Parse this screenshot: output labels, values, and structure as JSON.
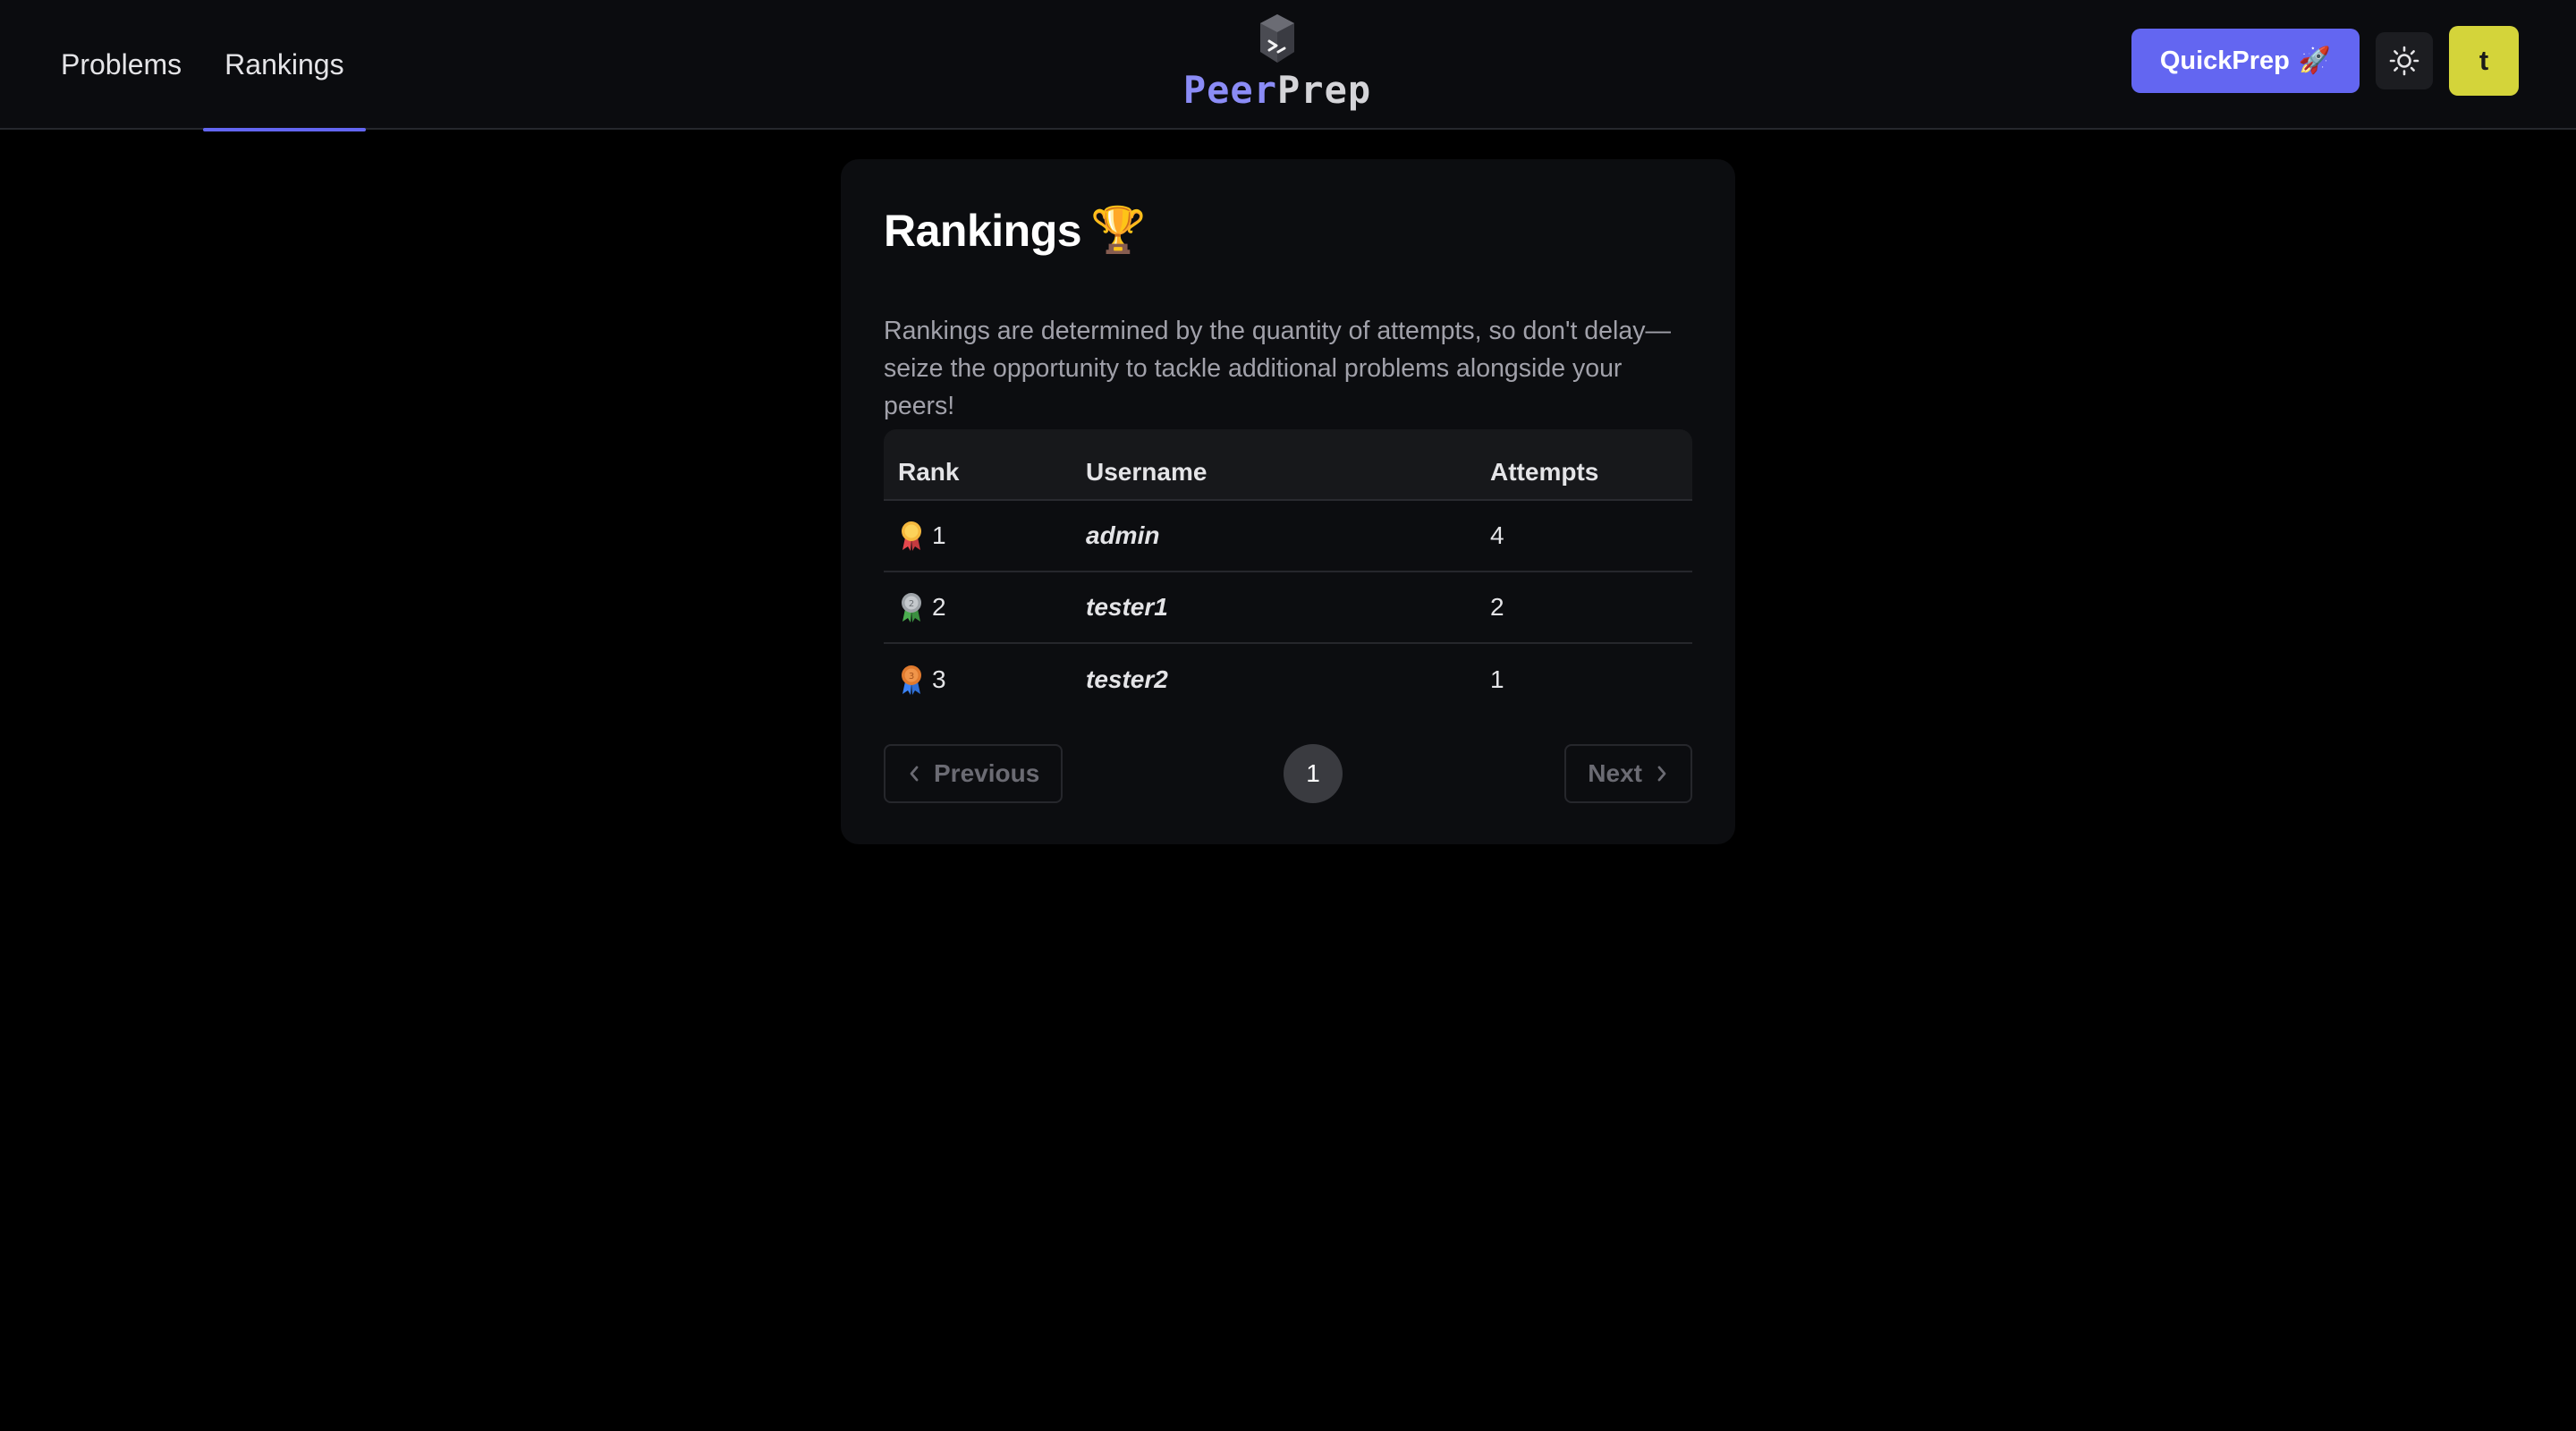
{
  "nav": {
    "links": [
      {
        "label": "Problems",
        "active": false
      },
      {
        "label": "Rankings",
        "active": true
      }
    ]
  },
  "brand": {
    "part1": "Peer",
    "part2": "Prep",
    "icon": "terminal-cube-icon"
  },
  "actions": {
    "quickprep_label": "QuickPrep",
    "quickprep_emoji": "🚀",
    "theme_icon": "sun-icon",
    "avatar_letter": "t",
    "avatar_color": "#d4d43a"
  },
  "rankings": {
    "title": "Rankings",
    "title_emoji": "🏆",
    "description": "Rankings are determined by the quantity of attempts, so don't delay—seize the opportunity to tackle additional problems alongside your peers!",
    "columns": [
      "Rank",
      "Username",
      "Attempts"
    ],
    "rows": [
      {
        "rank": "1",
        "medal": "gold-medal-icon",
        "username": "admin",
        "attempts": "4"
      },
      {
        "rank": "2",
        "medal": "silver-medal-icon",
        "username": "tester1",
        "attempts": "2"
      },
      {
        "rank": "3",
        "medal": "bronze-medal-icon",
        "username": "tester2",
        "attempts": "1"
      }
    ]
  },
  "pagination": {
    "previous_label": "Previous",
    "next_label": "Next",
    "current_page": "1"
  },
  "colors": {
    "accent": "#6366f1",
    "background": "#000000",
    "card": "#0c0d10"
  }
}
